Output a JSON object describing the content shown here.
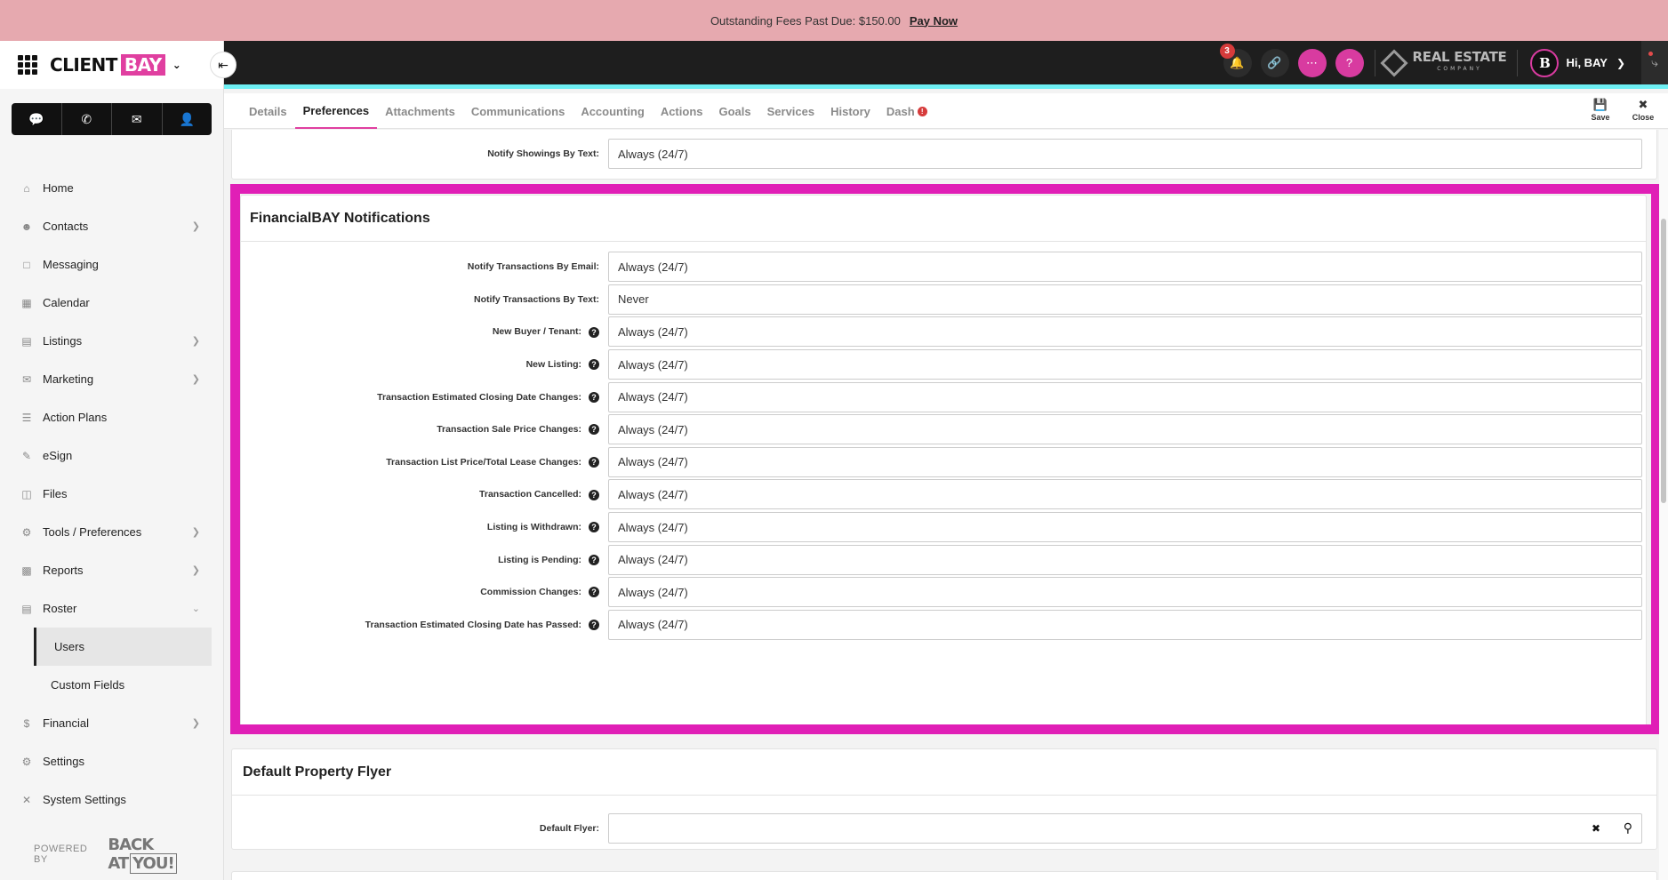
{
  "banner": {
    "text": "Outstanding Fees Past Due: $150.00",
    "link": "Pay Now"
  },
  "brand": {
    "client": "CLIENT",
    "bay": "BAY"
  },
  "quick_actions": [
    "chat-icon",
    "phone-icon",
    "email-icon",
    "add-contact-icon"
  ],
  "sidebar": {
    "items": [
      {
        "label": "Home",
        "icon": "home-icon",
        "has_children": false
      },
      {
        "label": "Contacts",
        "icon": "contacts-icon",
        "has_children": true
      },
      {
        "label": "Messaging",
        "icon": "messaging-icon",
        "has_children": false
      },
      {
        "label": "Calendar",
        "icon": "calendar-icon",
        "has_children": false
      },
      {
        "label": "Listings",
        "icon": "listings-icon",
        "has_children": true
      },
      {
        "label": "Marketing",
        "icon": "marketing-icon",
        "has_children": true
      },
      {
        "label": "Action Plans",
        "icon": "action-plans-icon",
        "has_children": false
      },
      {
        "label": "eSign",
        "icon": "esign-icon",
        "has_children": false
      },
      {
        "label": "Files",
        "icon": "files-icon",
        "has_children": false
      },
      {
        "label": "Tools / Preferences",
        "icon": "tools-icon",
        "has_children": true
      },
      {
        "label": "Reports",
        "icon": "reports-icon",
        "has_children": true
      },
      {
        "label": "Roster",
        "icon": "roster-icon",
        "has_children": true,
        "expanded": true
      }
    ],
    "roster_sub": [
      {
        "label": "Users",
        "active": true
      },
      {
        "label": "Custom Fields",
        "active": false
      }
    ],
    "items_after": [
      {
        "label": "Financial",
        "icon": "financial-icon",
        "has_children": true
      },
      {
        "label": "Settings",
        "icon": "settings-icon",
        "has_children": false
      },
      {
        "label": "System Settings",
        "icon": "system-settings-icon",
        "has_children": false
      }
    ],
    "powered_by": "POWERED BY",
    "powered_logo_a": "BACK AT",
    "powered_logo_b": "YOU!"
  },
  "header": {
    "notification_count": "3",
    "company_name": "REAL ESTATE",
    "company_sub": "COMPANY",
    "user_initial": "B",
    "greeting": "Hi, BAY"
  },
  "tabs": [
    {
      "label": "Details",
      "active": false
    },
    {
      "label": "Preferences",
      "active": true
    },
    {
      "label": "Attachments",
      "active": false
    },
    {
      "label": "Communications",
      "active": false
    },
    {
      "label": "Accounting",
      "active": false
    },
    {
      "label": "Actions",
      "active": false
    },
    {
      "label": "Goals",
      "active": false
    },
    {
      "label": "Services",
      "active": false
    },
    {
      "label": "History",
      "active": false
    },
    {
      "label": "Dash",
      "active": false,
      "alert": true
    }
  ],
  "tab_actions": {
    "save": "Save",
    "close": "Close"
  },
  "top_partial": {
    "label": "Notify Showings By Text:",
    "value": "Always (24/7)"
  },
  "financial_section": {
    "title": "FinancialBAY Notifications",
    "rows": [
      {
        "label": "Notify Transactions By Email:",
        "value": "Always (24/7)",
        "help": false
      },
      {
        "label": "Notify Transactions By Text:",
        "value": "Never",
        "help": false
      },
      {
        "label": "New Buyer / Tenant:",
        "value": "Always (24/7)",
        "help": true
      },
      {
        "label": "New Listing:",
        "value": "Always (24/7)",
        "help": true
      },
      {
        "label": "Transaction Estimated Closing Date Changes:",
        "value": "Always (24/7)",
        "help": true
      },
      {
        "label": "Transaction Sale Price Changes:",
        "value": "Always (24/7)",
        "help": true
      },
      {
        "label": "Transaction List Price/Total Lease Changes:",
        "value": "Always (24/7)",
        "help": true
      },
      {
        "label": "Transaction Cancelled:",
        "value": "Always (24/7)",
        "help": true
      },
      {
        "label": "Listing is Withdrawn:",
        "value": "Always (24/7)",
        "help": true
      },
      {
        "label": "Listing is Pending:",
        "value": "Always (24/7)",
        "help": true
      },
      {
        "label": "Commission Changes:",
        "value": "Always (24/7)",
        "help": true
      },
      {
        "label": "Transaction Estimated Closing Date has Passed:",
        "value": "Always (24/7)",
        "help": true
      }
    ]
  },
  "flyer_section": {
    "title": "Default Property Flyer",
    "label": "Default Flyer:",
    "value": ""
  },
  "colors": {
    "accent_pink": "#e03fa0",
    "highlight_border": "#e01fb6",
    "banner_bg": "#e6a9af",
    "header_bg": "#1e1e1e",
    "header_accent": "#6ef0f4"
  }
}
